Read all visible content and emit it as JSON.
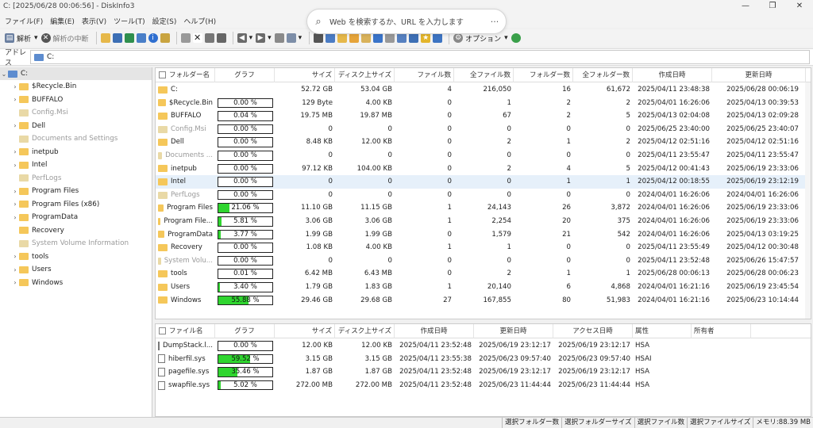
{
  "title": "C: [2025/06/28 00:06:56] - DiskInfo3",
  "window_controls": [
    "—",
    "❐",
    "✕"
  ],
  "menu": [
    "ファイル(F)",
    "編集(E)",
    "表示(V)",
    "ツール(T)",
    "設定(S)",
    "ヘルプ(H)"
  ],
  "browser_search": {
    "placeholder": "Web を検索するか、URL を入力します",
    "more": "···"
  },
  "toolbar": {
    "analyze": "解析",
    "stop": "解析の中断",
    "options": "オプション"
  },
  "address": {
    "label": "アドレス",
    "value": "C:"
  },
  "tree": {
    "root": "C:",
    "items": [
      {
        "label": "$Recycle.Bin",
        "expandable": true,
        "dim": false
      },
      {
        "label": "BUFFALO",
        "expandable": true,
        "dim": false
      },
      {
        "label": "Config.Msi",
        "expandable": false,
        "dim": true
      },
      {
        "label": "Dell",
        "expandable": true,
        "dim": false
      },
      {
        "label": "Documents and Settings",
        "expandable": false,
        "dim": true
      },
      {
        "label": "inetpub",
        "expandable": true,
        "dim": false
      },
      {
        "label": "Intel",
        "expandable": true,
        "dim": false
      },
      {
        "label": "PerfLogs",
        "expandable": false,
        "dim": true
      },
      {
        "label": "Program Files",
        "expandable": true,
        "dim": false
      },
      {
        "label": "Program Files (x86)",
        "expandable": true,
        "dim": false
      },
      {
        "label": "ProgramData",
        "expandable": true,
        "dim": false
      },
      {
        "label": "Recovery",
        "expandable": false,
        "dim": false
      },
      {
        "label": "System Volume Information",
        "expandable": false,
        "dim": true
      },
      {
        "label": "tools",
        "expandable": true,
        "dim": false
      },
      {
        "label": "Users",
        "expandable": true,
        "dim": false
      },
      {
        "label": "Windows",
        "expandable": true,
        "dim": false
      }
    ]
  },
  "folder_grid": {
    "columns": [
      "フォルダー名",
      "グラフ",
      "サイズ",
      "ディスク上サイズ",
      "ファイル数",
      "全ファイル数",
      "フォルダー数",
      "全フォルダー数",
      "作成日時",
      "更新日時"
    ],
    "rows": [
      {
        "name": "C:",
        "pct": null,
        "pct_label": "",
        "size": "52.72 GB",
        "disk": "53.04 GB",
        "files": "4",
        "all_files": "216,050",
        "folders": "16",
        "all_folders": "61,672",
        "created": "2025/04/11 23:48:38",
        "modified": "2025/06/28 00:06:19",
        "dim": false
      },
      {
        "name": "$Recycle.Bin",
        "pct": 0,
        "pct_label": "0.00 %",
        "size": "129 Byte",
        "disk": "4.00 KB",
        "files": "0",
        "all_files": "1",
        "folders": "2",
        "all_folders": "2",
        "created": "2025/04/01 16:26:06",
        "modified": "2025/04/13 00:39:53",
        "dim": false
      },
      {
        "name": "BUFFALO",
        "pct": 0.04,
        "pct_label": "0.04 %",
        "size": "19.75 MB",
        "disk": "19.87 MB",
        "files": "0",
        "all_files": "67",
        "folders": "2",
        "all_folders": "5",
        "created": "2025/04/13 02:04:08",
        "modified": "2025/04/13 02:09:28",
        "dim": false
      },
      {
        "name": "Config.Msi",
        "pct": 0,
        "pct_label": "0.00 %",
        "size": "0",
        "disk": "0",
        "files": "0",
        "all_files": "0",
        "folders": "0",
        "all_folders": "0",
        "created": "2025/06/25 23:40:00",
        "modified": "2025/06/25 23:40:07",
        "dim": true
      },
      {
        "name": "Dell",
        "pct": 0,
        "pct_label": "0.00 %",
        "size": "8.48 KB",
        "disk": "12.00 KB",
        "files": "0",
        "all_files": "2",
        "folders": "1",
        "all_folders": "2",
        "created": "2025/04/12 02:51:16",
        "modified": "2025/04/12 02:51:16",
        "dim": false
      },
      {
        "name": "Documents ...",
        "pct": 0,
        "pct_label": "0.00 %",
        "size": "0",
        "disk": "0",
        "files": "0",
        "all_files": "0",
        "folders": "0",
        "all_folders": "0",
        "created": "2025/04/11 23:55:47",
        "modified": "2025/04/11 23:55:47",
        "dim": true
      },
      {
        "name": "inetpub",
        "pct": 0,
        "pct_label": "0.00 %",
        "size": "97.12 KB",
        "disk": "104.00 KB",
        "files": "0",
        "all_files": "2",
        "folders": "4",
        "all_folders": "5",
        "created": "2025/04/12 00:41:43",
        "modified": "2025/06/19 23:33:06",
        "dim": false
      },
      {
        "name": "Intel",
        "pct": 0,
        "pct_label": "0.00 %",
        "size": "0",
        "disk": "0",
        "files": "0",
        "all_files": "0",
        "folders": "1",
        "all_folders": "1",
        "created": "2025/04/12 00:18:55",
        "modified": "2025/06/19 23:12:19",
        "dim": false,
        "selected": true
      },
      {
        "name": "PerfLogs",
        "pct": 0,
        "pct_label": "0.00 %",
        "size": "0",
        "disk": "0",
        "files": "0",
        "all_files": "0",
        "folders": "0",
        "all_folders": "0",
        "created": "2024/04/01 16:26:06",
        "modified": "2024/04/01 16:26:06",
        "dim": true
      },
      {
        "name": "Program Files",
        "pct": 21.06,
        "pct_label": "21.06 %",
        "size": "11.10 GB",
        "disk": "11.15 GB",
        "files": "1",
        "all_files": "24,143",
        "folders": "26",
        "all_folders": "3,872",
        "created": "2024/04/01 16:26:06",
        "modified": "2025/06/19 23:33:06",
        "dim": false
      },
      {
        "name": "Program File...",
        "pct": 5.81,
        "pct_label": "5.81 %",
        "size": "3.06 GB",
        "disk": "3.06 GB",
        "files": "1",
        "all_files": "2,254",
        "folders": "20",
        "all_folders": "375",
        "created": "2024/04/01 16:26:06",
        "modified": "2025/06/19 23:33:06",
        "dim": false
      },
      {
        "name": "ProgramData",
        "pct": 3.77,
        "pct_label": "3.77 %",
        "size": "1.99 GB",
        "disk": "1.99 GB",
        "files": "0",
        "all_files": "1,579",
        "folders": "21",
        "all_folders": "542",
        "created": "2024/04/01 16:26:06",
        "modified": "2025/04/13 03:19:25",
        "dim": false
      },
      {
        "name": "Recovery",
        "pct": 0,
        "pct_label": "0.00 %",
        "size": "1.08 KB",
        "disk": "4.00 KB",
        "files": "1",
        "all_files": "1",
        "folders": "0",
        "all_folders": "0",
        "created": "2025/04/11 23:55:49",
        "modified": "2025/04/12 00:30:48",
        "dim": false
      },
      {
        "name": "System Volu...",
        "pct": 0,
        "pct_label": "0.00 %",
        "size": "0",
        "disk": "0",
        "files": "0",
        "all_files": "0",
        "folders": "0",
        "all_folders": "0",
        "created": "2025/04/11 23:52:48",
        "modified": "2025/06/26 15:47:57",
        "dim": true
      },
      {
        "name": "tools",
        "pct": 0.01,
        "pct_label": "0.01 %",
        "size": "6.42 MB",
        "disk": "6.43 MB",
        "files": "0",
        "all_files": "2",
        "folders": "1",
        "all_folders": "1",
        "created": "2025/06/28 00:06:13",
        "modified": "2025/06/28 00:06:23",
        "dim": false
      },
      {
        "name": "Users",
        "pct": 3.4,
        "pct_label": "3.40 %",
        "size": "1.79 GB",
        "disk": "1.83 GB",
        "files": "1",
        "all_files": "20,140",
        "folders": "6",
        "all_folders": "4,868",
        "created": "2024/04/01 16:21:16",
        "modified": "2025/06/19 23:45:54",
        "dim": false
      },
      {
        "name": "Windows",
        "pct": 55.88,
        "pct_label": "55.88 %",
        "size": "29.46 GB",
        "disk": "29.68 GB",
        "files": "27",
        "all_files": "167,855",
        "folders": "80",
        "all_folders": "51,983",
        "created": "2024/04/01 16:21:16",
        "modified": "2025/06/23 10:14:44",
        "dim": false
      }
    ]
  },
  "file_grid": {
    "columns": [
      "ファイル名",
      "グラフ",
      "サイズ",
      "ディスク上サイズ",
      "作成日時",
      "更新日時",
      "アクセス日時",
      "属性",
      "所有者"
    ],
    "rows": [
      {
        "name": "DumpStack.l...",
        "pct": 0,
        "pct_label": "0.00 %",
        "size": "12.00 KB",
        "disk": "12.00 KB",
        "created": "2025/04/11 23:52:48",
        "modified": "2025/06/19 23:12:17",
        "accessed": "2025/06/19 23:12:17",
        "attr": "HSA",
        "owner": ""
      },
      {
        "name": "hiberfil.sys",
        "pct": 59.52,
        "pct_label": "59.52 %",
        "size": "3.15 GB",
        "disk": "3.15 GB",
        "created": "2025/04/11 23:55:38",
        "modified": "2025/06/23 09:57:40",
        "accessed": "2025/06/23 09:57:40",
        "attr": "HSAI",
        "owner": ""
      },
      {
        "name": "pagefile.sys",
        "pct": 35.46,
        "pct_label": "35.46 %",
        "size": "1.87 GB",
        "disk": "1.87 GB",
        "created": "2025/04/11 23:52:48",
        "modified": "2025/06/19 23:12:17",
        "accessed": "2025/06/19 23:12:17",
        "attr": "HSA",
        "owner": ""
      },
      {
        "name": "swapfile.sys",
        "pct": 5.02,
        "pct_label": "5.02 %",
        "size": "272.00 MB",
        "disk": "272.00 MB",
        "created": "2025/04/11 23:52:48",
        "modified": "2025/06/23 11:44:44",
        "accessed": "2025/06/23 11:44:44",
        "attr": "HSA",
        "owner": ""
      }
    ]
  },
  "status": [
    "選択フォルダー数",
    "選択フォルダーサイズ",
    "選択ファイル数",
    "選択ファイルサイズ",
    "メモリ:88.39 MB"
  ]
}
